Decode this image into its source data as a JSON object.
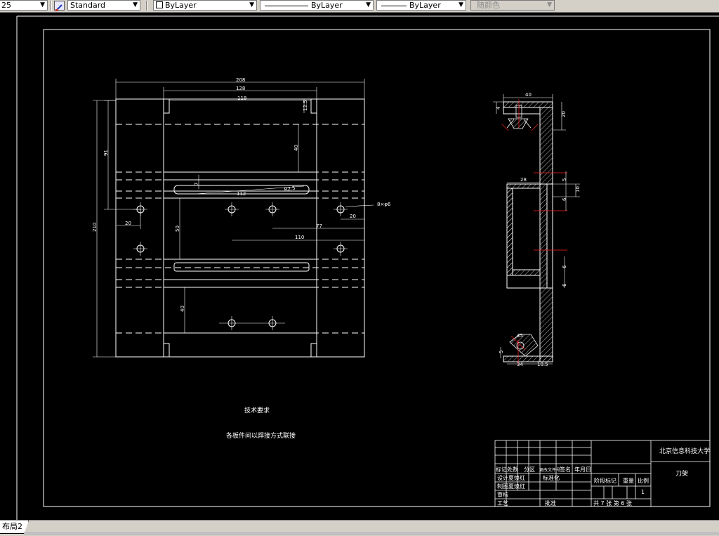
{
  "toolbar": {
    "scale_value": "25",
    "text_style_value": "Standard",
    "layer_value": "ByLayer",
    "linetype_value": "ByLayer",
    "lineweight_value": "ByLayer",
    "plotstyle_value": "随颜色"
  },
  "drawing": {
    "front_view": {
      "dims": {
        "overall_width": "208",
        "inner_width": "128",
        "slot_width": "118",
        "corner_dim": "12.5",
        "dim_40_upper": "40",
        "dim_91": "91",
        "dim_210": "210",
        "slot_length": "112",
        "slot_radius": "R2.5",
        "dim_20_left": "20",
        "dim_20_right": "20",
        "hole_callout": "8×φ6",
        "dim_50": "50",
        "dim_77": "77",
        "dim_110": "110",
        "dim_40_lower": "40",
        "dim_7": "7"
      }
    },
    "section_view": {
      "dims": {
        "top_width": "40",
        "top_left": "4",
        "top_right": "20",
        "dim_28": "28",
        "dim_10": "10",
        "dim_5a": "5",
        "dim_6a": "6",
        "dim_6b": "6",
        "dim_6c": "6",
        "bottom_width": "34",
        "bottom_small": "10.5",
        "bottom_left": "5",
        "dim_45": "45"
      }
    },
    "notes": {
      "heading": "技术要求",
      "line1": "各板件间以焊接方式联接"
    },
    "title_block": {
      "university": "北京信息科技大学",
      "part_name": "刀架",
      "header_row": [
        "标记",
        "处数",
        "分区",
        "更改文件号",
        "签名",
        "年月日"
      ],
      "design_row": [
        "设计",
        "夏焕红",
        "标准化"
      ],
      "drawing_row": [
        "制图",
        "夏焕红"
      ],
      "check_label": "审核",
      "process_label": "工艺",
      "approve_label": "批准",
      "stage_label": "阶段标记",
      "weight_label": "重量",
      "scale_label": "比例",
      "scale_value": "1",
      "sheets": "共 7 张 第 6 张"
    }
  },
  "layout_tabs": {
    "active_tab": "布局2"
  }
}
